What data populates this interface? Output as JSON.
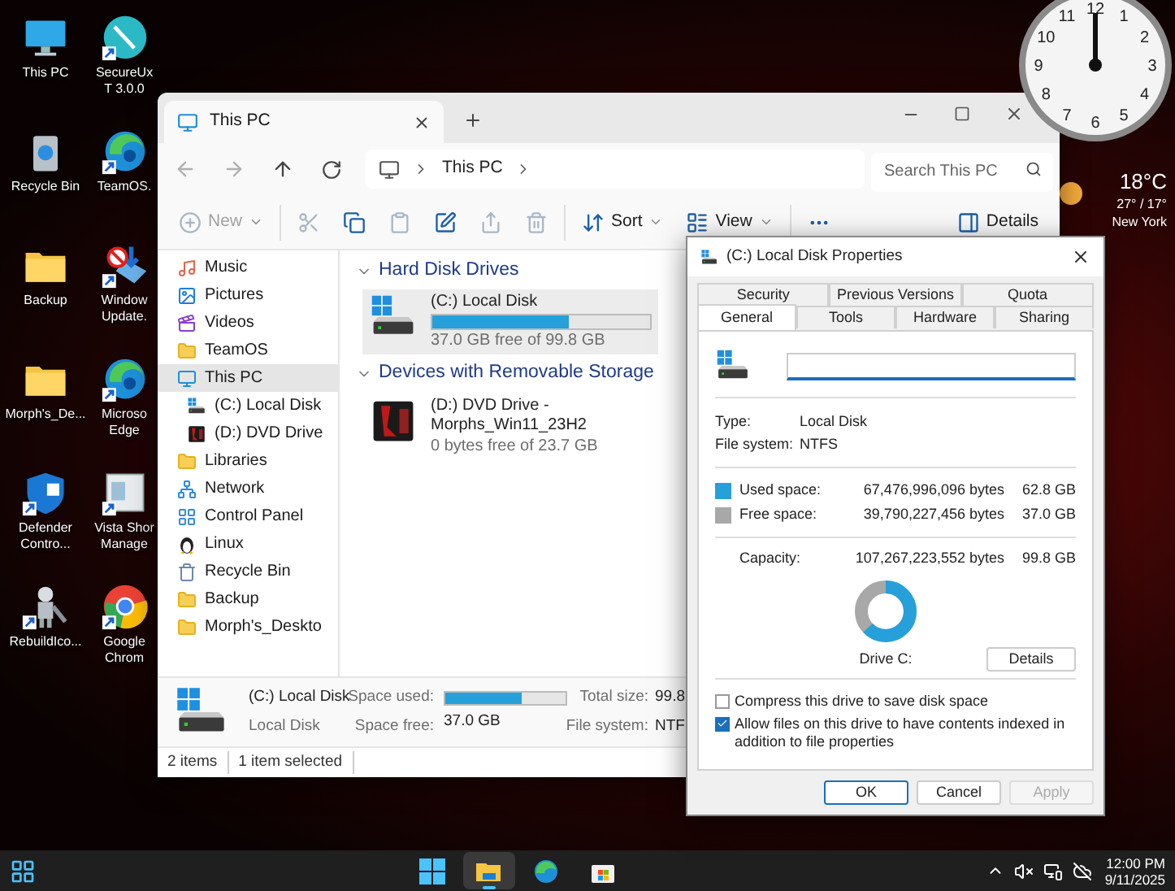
{
  "desktop_icons": [
    {
      "label": "This PC",
      "kind": "pc",
      "shortcut": false
    },
    {
      "label": "SecureUxT 3.0.0",
      "kind": "pen",
      "shortcut": true
    },
    {
      "label": "Recycle Bin",
      "kind": "bin",
      "shortcut": false
    },
    {
      "label": "TeamOS.",
      "kind": "edge",
      "shortcut": true
    },
    {
      "label": "Backup",
      "kind": "folder",
      "shortcut": false
    },
    {
      "label": "Window Update.",
      "kind": "update",
      "shortcut": true
    },
    {
      "label": "Morph's_De...",
      "kind": "folder",
      "shortcut": false
    },
    {
      "label": "Microso Edge",
      "kind": "edge",
      "shortcut": true
    },
    {
      "label": "Defender Contro...",
      "kind": "defender",
      "shortcut": true
    },
    {
      "label": "Vista Shor Manage",
      "kind": "vista",
      "shortcut": true
    },
    {
      "label": "RebuildIco...",
      "kind": "robot",
      "shortcut": true
    },
    {
      "label": "Google Chrom",
      "kind": "chrome",
      "shortcut": true
    }
  ],
  "clock": {
    "numerals": [
      "12",
      "11",
      "1",
      "10",
      "2",
      "9",
      "3",
      "8",
      "4",
      "7",
      "5",
      "6"
    ]
  },
  "weather": {
    "temperature": "18°C",
    "range": "27° / 17°",
    "city": "New York"
  },
  "explorer": {
    "tabs": [
      {
        "label": "This PC",
        "selected": true
      }
    ],
    "address": [
      "This PC"
    ],
    "search": {
      "placeholder": "Search This PC"
    },
    "toolbar": [
      {
        "kind": "new",
        "label": "New",
        "disabled": true
      },
      {
        "kind": "cut",
        "disabled": true
      },
      {
        "kind": "copy",
        "disabled": false
      },
      {
        "kind": "paste",
        "disabled": true
      },
      {
        "kind": "rename",
        "disabled": false
      },
      {
        "kind": "share",
        "disabled": true
      },
      {
        "kind": "delete",
        "disabled": true
      },
      {
        "kind": "sort",
        "label": "Sort",
        "disabled": false
      },
      {
        "kind": "view",
        "label": "View",
        "disabled": false
      },
      {
        "kind": "more",
        "disabled": false
      },
      {
        "kind": "details",
        "label": "Details",
        "disabled": false
      }
    ],
    "sidebar": [
      {
        "label": "Music",
        "kind": "music",
        "selected": false
      },
      {
        "label": "Pictures",
        "kind": "pictures",
        "selected": false
      },
      {
        "label": "Videos",
        "kind": "videos",
        "selected": false
      },
      {
        "label": "TeamOS",
        "kind": "folder",
        "selected": false
      },
      {
        "label": "This PC",
        "kind": "pc",
        "selected": true,
        "children": [
          {
            "label": "(C:) Local Disk",
            "kind": "hdd",
            "selected": false
          },
          {
            "label": "(D:) DVD Drive",
            "kind": "dvd",
            "selected": false
          }
        ]
      },
      {
        "label": "Libraries",
        "kind": "folder",
        "selected": false
      },
      {
        "label": "Network",
        "kind": "network",
        "selected": false
      },
      {
        "label": "Control Panel",
        "kind": "control",
        "selected": false
      },
      {
        "label": "Linux",
        "kind": "linux",
        "selected": false
      },
      {
        "label": "Recycle Bin",
        "kind": "bin",
        "selected": false
      },
      {
        "label": "Backup",
        "kind": "folder",
        "selected": false
      },
      {
        "label": "Morph's_Deskto",
        "kind": "folder",
        "selected": false
      }
    ],
    "groups": [
      {
        "title": "Hard Disk Drives",
        "expanded": true,
        "drives": [
          {
            "label": "(C:) Local Disk",
            "kind": "hdd",
            "level": 0.63,
            "free": "37.0 GB free of 99.8 GB",
            "selected": true
          }
        ]
      },
      {
        "title": "Devices with Removable Storage",
        "expanded": true,
        "drives": [
          {
            "label": "(D:) DVD Drive - Morphs_Win11_23H2",
            "kind": "dvd",
            "free": "0 bytes free of 23.7 GB",
            "selected": false
          }
        ]
      }
    ],
    "details_pane": {
      "name": "(C:) Local Disk",
      "type": "Local Disk",
      "used_label": "Space used:",
      "level": 0.63,
      "free_label": "Space free:",
      "free": "37.0 GB",
      "total_label": "Total size:",
      "total": "99.8",
      "fs_label": "File system:",
      "fs": "NTF"
    },
    "status_bar": [
      "2 items",
      "1 item selected"
    ]
  },
  "properties_dialog": {
    "title": "(C:) Local Disk Properties",
    "tab_rows": [
      [
        {
          "label": "Security",
          "selected": false
        },
        {
          "label": "Previous Versions",
          "selected": false
        },
        {
          "label": "Quota",
          "selected": false
        }
      ],
      [
        {
          "label": "General",
          "selected": true
        },
        {
          "label": "Tools",
          "selected": false
        },
        {
          "label": "Hardware",
          "selected": false
        },
        {
          "label": "Sharing",
          "selected": false
        }
      ]
    ],
    "info": [
      {
        "label": "Type:",
        "value": "Local Disk"
      },
      {
        "label": "File system:",
        "value": "NTFS"
      }
    ],
    "usage": [
      {
        "label": "Used space:",
        "bytes": "67,476,996,096 bytes",
        "size": "62.8 GB",
        "color": "#26a0da"
      },
      {
        "label": "Free space:",
        "bytes": "39,790,227,456 bytes",
        "size": "37.0 GB",
        "color": "#a8a8a8"
      }
    ],
    "capacity": {
      "label": "Capacity:",
      "bytes": "107,267,223,552 bytes",
      "size": "99.8 GB"
    },
    "donut": {
      "level": 0.63,
      "caption": "Drive C:"
    },
    "details_button": "Details",
    "options": [
      {
        "label": "Compress this drive to save disk space",
        "checked": false
      },
      {
        "label": "Allow files on this drive to have contents indexed in addition to file properties",
        "checked": true
      }
    ],
    "buttons": [
      {
        "label": "OK",
        "default": true,
        "disabled": false
      },
      {
        "label": "Cancel",
        "default": false,
        "disabled": false
      },
      {
        "label": "Apply",
        "default": false,
        "disabled": true
      }
    ]
  },
  "taskbar": {
    "apps": [
      {
        "kind": "start",
        "selected": false
      },
      {
        "kind": "explorer",
        "selected": true
      },
      {
        "kind": "edge",
        "selected": false
      },
      {
        "kind": "store",
        "selected": false
      }
    ],
    "time": "12:00 PM",
    "date": "9/11/2025"
  }
}
